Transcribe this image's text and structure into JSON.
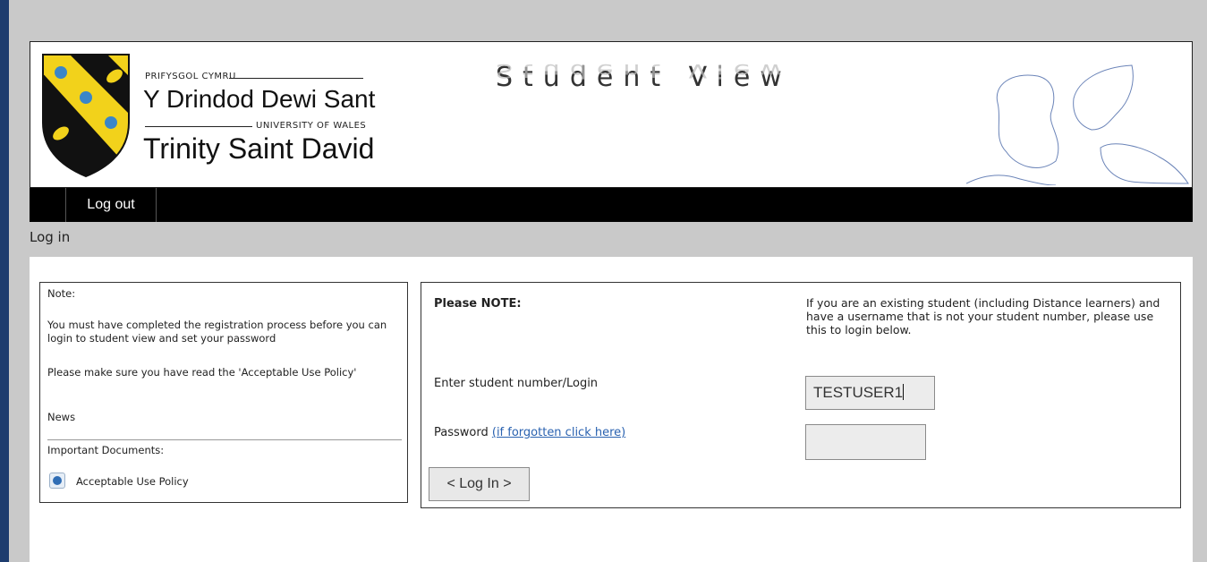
{
  "header": {
    "brand_top": "PRIFYSGOL CYMRU",
    "brand_welsh": "Y Drindod Dewi Sant",
    "brand_uow": "UNIVERSITY OF WALES",
    "brand_english": "Trinity Saint David",
    "app_title": "Student View"
  },
  "nav": {
    "logout": "Log out"
  },
  "page": {
    "section_title": "Log in"
  },
  "note_panel": {
    "heading": "Note:",
    "registration": "You must have completed the registration process before you can login to student view and set your password",
    "policy_reminder": "Please make sure you have read the 'Acceptable Use Policy'",
    "news": "News",
    "documents_heading": "Important Documents:",
    "documents": [
      {
        "label": "Acceptable Use Policy",
        "icon": "globe-icon"
      }
    ]
  },
  "login_form": {
    "please_note": "Please NOTE:",
    "info": "If you are an existing student (including Distance learners) and have a username that is not your student number, please use this to login below.",
    "login_label": "Enter student number/Login",
    "login_value": "TESTUSER1",
    "password_label": "Password",
    "forgot_link": "(if forgotten click here)",
    "password_value": "",
    "submit_label": "< Log In >"
  },
  "colors": {
    "background": "#c9c9c9",
    "left_bar": "#1d3c6e",
    "nav_bar": "#000000",
    "shield_yellow": "#f2d21b",
    "shield_black": "#111111",
    "link": "#2a62b0"
  }
}
